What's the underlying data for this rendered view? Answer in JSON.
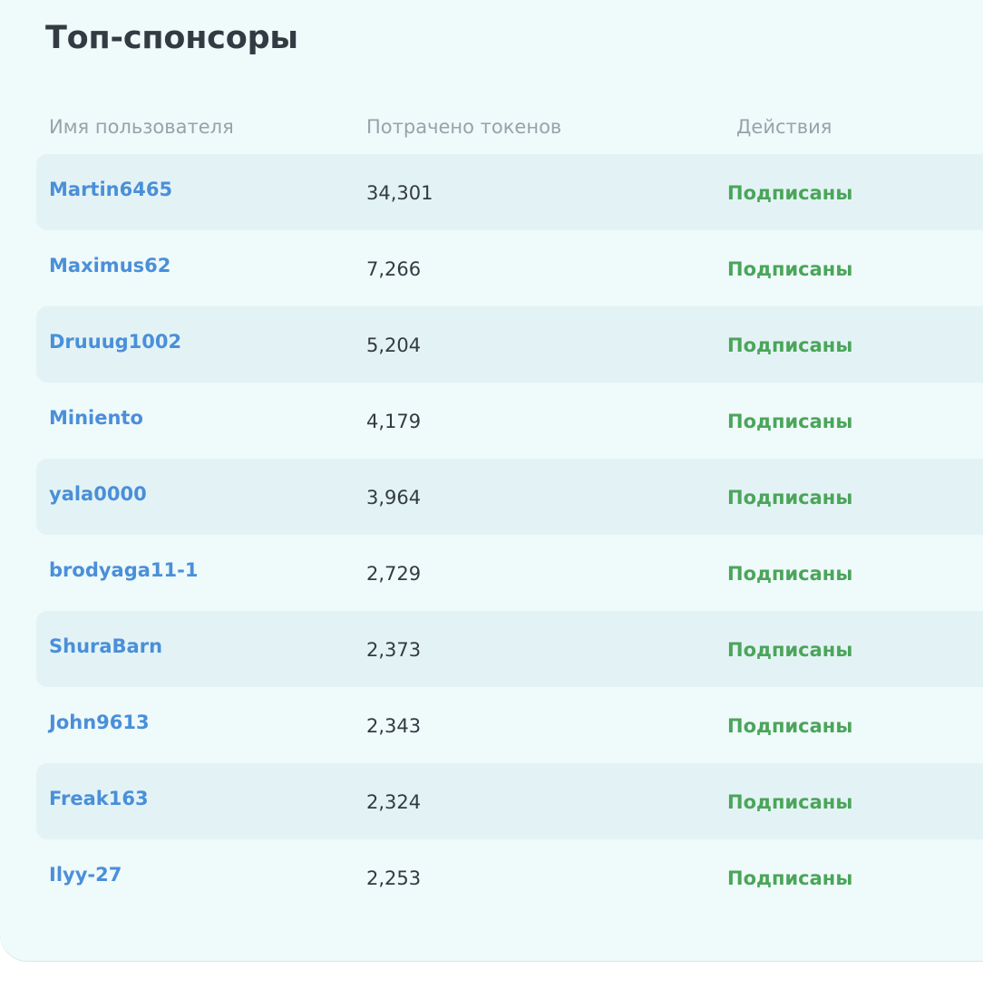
{
  "page": {
    "title": "Топ-спонсоры"
  },
  "table": {
    "headers": {
      "username": "Имя пользователя",
      "spent": "Потрачено токенов",
      "actions": "Действия"
    },
    "rows": [
      {
        "username": "Martin6465",
        "spent": "34,301",
        "action": "Подписаны"
      },
      {
        "username": "Maximus62",
        "spent": "7,266",
        "action": "Подписаны"
      },
      {
        "username": "Druuug1002",
        "spent": "5,204",
        "action": "Подписаны"
      },
      {
        "username": "Miniento",
        "spent": "4,179",
        "action": "Подписаны"
      },
      {
        "username": "yala0000",
        "spent": "3,964",
        "action": "Подписаны"
      },
      {
        "username": "brodyaga11-1",
        "spent": "2,729",
        "action": "Подписаны"
      },
      {
        "username": "ShuraBarn",
        "spent": "2,373",
        "action": "Подписаны"
      },
      {
        "username": "John9613",
        "spent": "2,343",
        "action": "Подписаны"
      },
      {
        "username": "Freak163",
        "spent": "2,324",
        "action": "Подписаны"
      },
      {
        "username": "Ilyy-27",
        "spent": "2,253",
        "action": "Подписаны"
      }
    ]
  },
  "colors": {
    "panel_bg": "#effafb",
    "row_shaded": "#e3f3f5",
    "title": "#333b42",
    "header": "#98a3a9",
    "link": "#4a8fd9",
    "subscribed": "#4ba55a"
  }
}
